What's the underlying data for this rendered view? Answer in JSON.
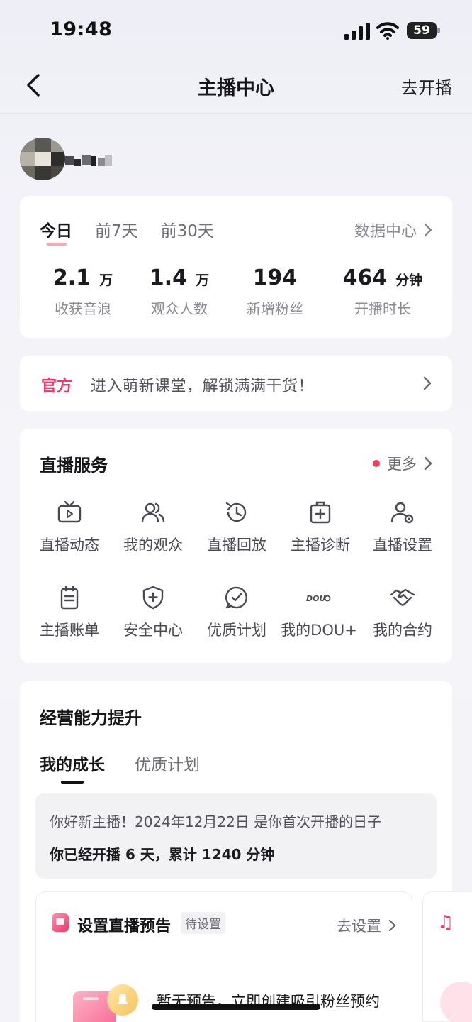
{
  "status_bar": {
    "time": "19:48",
    "battery": "59"
  },
  "nav": {
    "title": "主播中心",
    "action": "去开播"
  },
  "stats": {
    "tabs": [
      "今日",
      "前7天",
      "前30天"
    ],
    "data_center": "数据中心",
    "items": [
      {
        "value": "2.1",
        "unit": "万",
        "label": "收获音浪"
      },
      {
        "value": "1.4",
        "unit": "万",
        "label": "观众人数"
      },
      {
        "value": "194",
        "unit": "",
        "label": "新增粉丝"
      },
      {
        "value": "464",
        "unit": "分钟",
        "label": "开播时长"
      }
    ]
  },
  "banner": {
    "tag": "官方",
    "text": "进入萌新课堂，解锁满满干货！"
  },
  "services": {
    "title": "直播服务",
    "more": "更多",
    "items": [
      {
        "label": "直播动态",
        "icon": "tv-icon"
      },
      {
        "label": "我的观众",
        "icon": "audience-icon"
      },
      {
        "label": "直播回放",
        "icon": "replay-clock-icon"
      },
      {
        "label": "主播诊断",
        "icon": "medical-kit-icon"
      },
      {
        "label": "直播设置",
        "icon": "user-settings-icon"
      },
      {
        "label": "主播账单",
        "icon": "bill-icon"
      },
      {
        "label": "安全中心",
        "icon": "shield-icon"
      },
      {
        "label": "优质计划",
        "icon": "check-chat-icon"
      },
      {
        "label": "我的DOU+",
        "icon": "dou-icon",
        "icon_text": "DOU"
      },
      {
        "label": "我的合约",
        "icon": "handshake-icon"
      }
    ]
  },
  "growth": {
    "title": "经营能力提升",
    "tabs": [
      "我的成长",
      "优质计划"
    ],
    "welcome_line1": "你好新主播！2024年12月22日 是你首次开播的日子",
    "welcome_line2": "你已经开播 6 天，累计 1240 分钟",
    "preview": {
      "title": "设置直播预告",
      "badge": "待设置",
      "action": "去设置",
      "empty_text": "暂无预告，立即创建吸引粉丝预约"
    }
  },
  "colors": {
    "accent": "#f0366a",
    "dot": "#f5385e"
  }
}
